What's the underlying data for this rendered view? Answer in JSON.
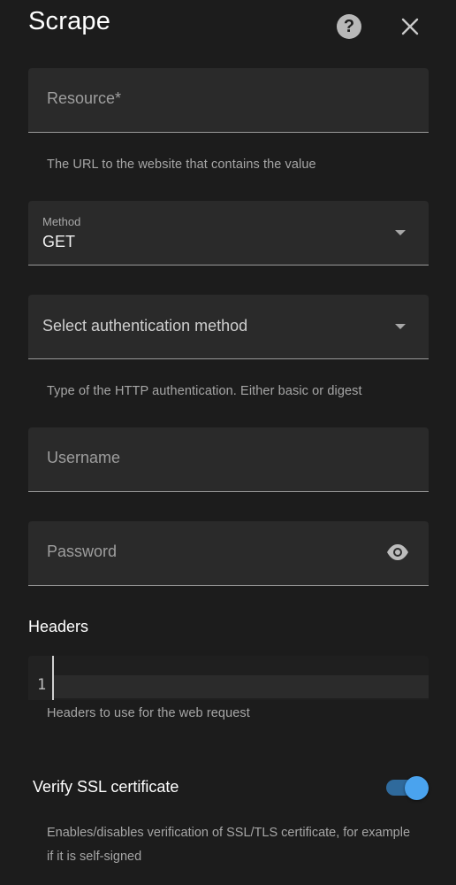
{
  "dialog": {
    "title": "Scrape",
    "help_icon": "help-circle-icon",
    "close_icon": "close-icon"
  },
  "resource": {
    "label": "Resource*",
    "helper": "The URL to the website that contains the value"
  },
  "method": {
    "label": "Method",
    "value": "GET",
    "icon": "chevron-down-icon"
  },
  "authentication": {
    "placeholder": "Select authentication method",
    "helper": "Type of the HTTP authentication. Either basic or digest"
  },
  "username": {
    "label": "Username"
  },
  "password": {
    "label": "Password",
    "icon": "eye-icon"
  },
  "headers": {
    "title": "Headers",
    "line_number": "1",
    "helper": "Headers to use for the web request"
  },
  "verify_ssl": {
    "label": "Verify SSL certificate",
    "enabled": true,
    "helper": "Enables/disables verification of SSL/TLS certificate, for example if it is self-signed"
  },
  "colors": {
    "background": "#1c1c1c",
    "field_background": "#2a2a2a",
    "accent": "#4aa3ee"
  }
}
